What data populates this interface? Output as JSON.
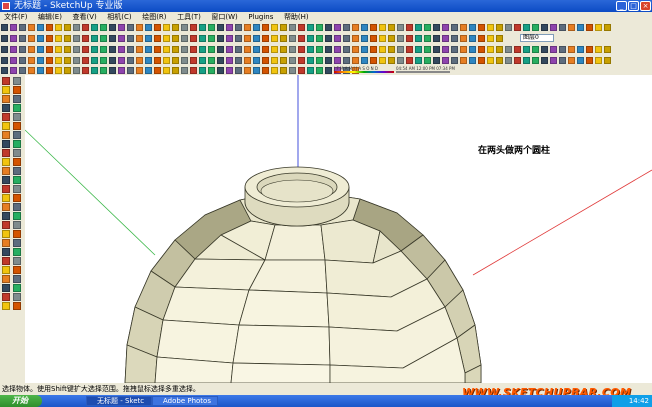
{
  "window": {
    "title": "无标题 - SketchUp 专业版",
    "controls": [
      "minimize-icon",
      "maximize-icon",
      "close-icon"
    ]
  },
  "menu": {
    "items": [
      "文件(F)",
      "编辑(E)",
      "查看(V)",
      "相机(C)",
      "绘图(R)",
      "工具(T)",
      "窗口(W)",
      "Plugins",
      "帮助(H)"
    ]
  },
  "toolbar": {
    "layer_select": "图层0",
    "shadow_months": "J F M A M J J A S O N D",
    "shadow_time_start": "04:54 AM",
    "shadow_time_noon": "12:00 PM",
    "shadow_time_end": "07:34 PM"
  },
  "viewport": {
    "annotation": "在两头做两个圆柱"
  },
  "status": {
    "text": "选择物体。使用Shift键扩大选择范围。拖拽鼠标选择多重选择。"
  },
  "watermark": "WWW.SKETCHUPBAR.COM",
  "taskbar": {
    "start": "开始",
    "buttons": [
      "无标题 - Sketc",
      "Adobe Photos"
    ],
    "clock": "14:42"
  }
}
